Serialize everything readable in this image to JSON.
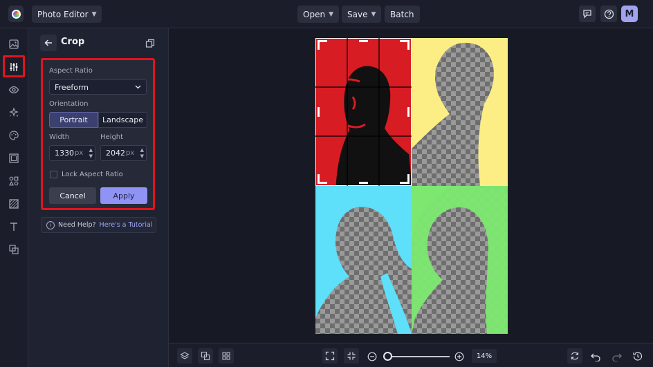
{
  "header": {
    "app_title": "Photo Editor",
    "menu": {
      "open": "Open",
      "save": "Save",
      "batch": "Batch"
    },
    "avatar_initial": "M"
  },
  "panel": {
    "title": "Crop",
    "aspect_ratio_label": "Aspect Ratio",
    "aspect_ratio_value": "Freeform",
    "orientation_label": "Orientation",
    "orientation_options": [
      "Portrait",
      "Landscape"
    ],
    "orientation_selected": "Portrait",
    "width_label": "Width",
    "width_value": "1330",
    "height_label": "Height",
    "height_value": "2042",
    "unit": "px",
    "lock_label": "Lock Aspect Ratio",
    "lock_checked": false,
    "cancel_label": "Cancel",
    "apply_label": "Apply",
    "help_text": "Need Help?",
    "help_link": "Here's a Tutorial"
  },
  "zoom": {
    "value_label": "14%"
  },
  "colors": {
    "accent": "#8f93f3",
    "highlight": "#e0141e",
    "quad_red": "#d81c24",
    "quad_yellow": "#fcee84",
    "quad_cyan": "#5ee0fa",
    "quad_green": "#7ce870"
  }
}
